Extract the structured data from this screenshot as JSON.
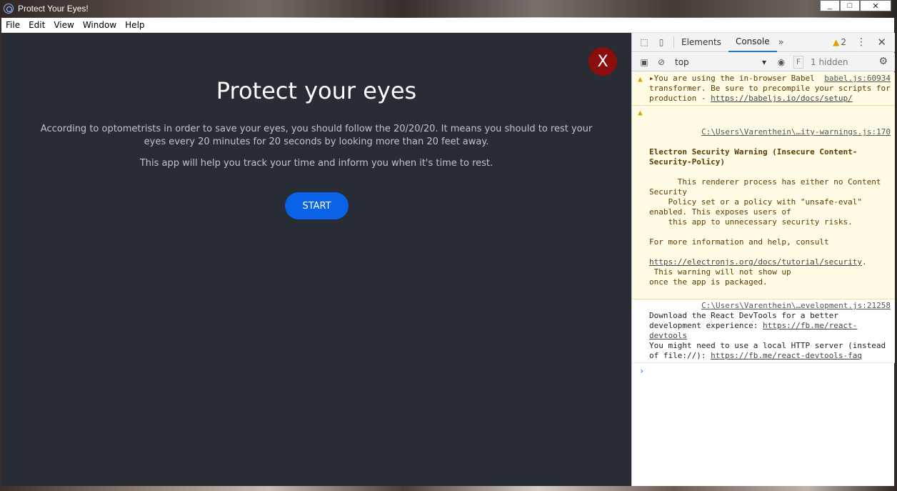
{
  "window": {
    "title": "Protect Your Eyes!",
    "controls": [
      "_",
      "□",
      "✕"
    ]
  },
  "menu": {
    "items": [
      "File",
      "Edit",
      "View",
      "Window",
      "Help"
    ]
  },
  "app": {
    "close_label": "X",
    "heading": "Protect your eyes",
    "description": "According to optometrists in order to save your eyes, you should follow the 20/20/20. It means you should to rest your eyes every 20 minutes for 20 seconds by looking more than 20 feet away.",
    "description2": "This app will help you track your time and inform you when it's time to rest.",
    "start_label": "START",
    "background": "#282c34",
    "button_color": "#0a62e6",
    "close_color": "#8b0d0d"
  },
  "devtools": {
    "tabs": [
      "Elements",
      "Console"
    ],
    "active_tab": "Console",
    "warning_count": "2",
    "context": "top",
    "filter_placeholder": "F",
    "hidden": "1 hidden",
    "messages": [
      {
        "type": "warn",
        "src": "babel.js:60934",
        "text": "▸You are using the in-browser Babel transformer. Be sure to precompile your scripts for production -",
        "link": "https://babeljs.io/docs/setup/"
      },
      {
        "type": "warn",
        "src": "C:\\Users\\Varenthein\\…ity-warnings.js:170",
        "title": "Electron Security Warning (Insecure Content-Security-Policy)",
        "text": "This renderer process has either no Content Security\n    Policy set or a policy with \"unsafe-eval\"\nenabled. This exposes users of\n    this app to unnecessary security risks.\n\nFor more information and help, consult",
        "link": "https://electronjs.org/docs/tutorial/security",
        "tail": ".\n This warning will not show up\nonce the app is packaged."
      },
      {
        "type": "info",
        "src": "C:\\Users\\Varenthein\\…evelopment.js:21258",
        "text": "Download the React DevTools for a better development experience:",
        "link": "https://fb.me/react-devtools",
        "text2": "You might need to use a local HTTP server (instead of file://):",
        "link2": "https://fb.me/react-devtools-faq"
      }
    ],
    "prompt": "›"
  }
}
